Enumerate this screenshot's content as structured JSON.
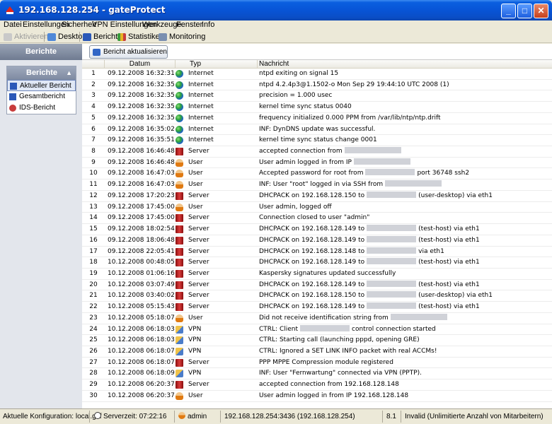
{
  "window": {
    "title": "192.168.128.254 - gateProtect",
    "controls": {
      "minimize": "_",
      "maximize": "□",
      "close": "✕"
    }
  },
  "menu": [
    "Datei",
    "Einstellungen",
    "Sicherheit",
    "VPN Einstellungen",
    "Werkzeuge",
    "Fenster",
    "Info"
  ],
  "toolbar": {
    "activate": "Aktivieren",
    "desktop": "Desktop",
    "reports": "Berichte",
    "statistics": "Statistiken",
    "monitoring": "Monitoring"
  },
  "sidebar": {
    "header": "Berichte",
    "panel_title": "Berichte",
    "items": [
      "Aktueller Bericht",
      "Gesamtbericht",
      "IDS-Bericht"
    ]
  },
  "update_button": "Bericht aktualisieren",
  "columns": {
    "num": "",
    "date": "Datum",
    "type": "Typ",
    "message": "Nachricht"
  },
  "rows": [
    {
      "n": "1",
      "date": "09.12.2008 16:32:31",
      "type": "Internet",
      "msg": "ntpd exiting on signal 15"
    },
    {
      "n": "2",
      "date": "09.12.2008 16:32:35",
      "type": "Internet",
      "msg": "ntpd 4.2.4p3@1.1502-o Mon Sep 29 19:44:10 UTC 2008 (1)"
    },
    {
      "n": "3",
      "date": "09.12.2008 16:32:35",
      "type": "Internet",
      "msg": "precision = 1.000 usec"
    },
    {
      "n": "4",
      "date": "09.12.2008 16:32:35",
      "type": "Internet",
      "msg": "kernel time sync status 0040"
    },
    {
      "n": "5",
      "date": "09.12.2008 16:32:35",
      "type": "Internet",
      "msg": "frequency initialized 0.000 PPM from /var/lib/ntp/ntp.drift"
    },
    {
      "n": "6",
      "date": "09.12.2008 16:35:02",
      "type": "Internet",
      "msg": "INF: DynDNS update was successful."
    },
    {
      "n": "7",
      "date": "09.12.2008 16:35:51",
      "type": "Internet",
      "msg": "kernel time sync status change 0001"
    },
    {
      "n": "8",
      "date": "09.12.2008 16:46:48",
      "type": "Server",
      "msg": "accepted connection from"
    },
    {
      "n": "9",
      "date": "09.12.2008 16:46:48",
      "type": "User",
      "msg": "User admin logged in from IP"
    },
    {
      "n": "10",
      "date": "09.12.2008 16:47:03",
      "type": "User",
      "msg": "Accepted password for root from",
      "msg2": "port 36748 ssh2"
    },
    {
      "n": "11",
      "date": "09.12.2008 16:47:03",
      "type": "User",
      "msg": "INF: User \"root\" logged in via SSH from"
    },
    {
      "n": "12",
      "date": "09.12.2008 17:20:23",
      "type": "Server",
      "msg": "DHCPACK on 192.168.128.150 to",
      "msg2": "(user-desktop) via eth1"
    },
    {
      "n": "13",
      "date": "09.12.2008 17:45:00",
      "type": "User",
      "msg": "User admin, logged off"
    },
    {
      "n": "14",
      "date": "09.12.2008 17:45:00",
      "type": "Server",
      "msg": "Connection closed to user \"admin\""
    },
    {
      "n": "15",
      "date": "09.12.2008 18:02:54",
      "type": "Server",
      "msg": "DHCPACK on 192.168.128.149 to",
      "msg2": "(test-host) via eth1"
    },
    {
      "n": "16",
      "date": "09.12.2008 18:06:48",
      "type": "Server",
      "msg": "DHCPACK on 192.168.128.149 to",
      "msg2": "(test-host) via eth1"
    },
    {
      "n": "17",
      "date": "09.12.2008 22:05:41",
      "type": "Server",
      "msg": "DHCPACK on 192.168.128.148 to",
      "msg2": "via eth1"
    },
    {
      "n": "18",
      "date": "10.12.2008 00:48:05",
      "type": "Server",
      "msg": "DHCPACK on 192.168.128.149 to",
      "msg2": "(test-host) via eth1"
    },
    {
      "n": "19",
      "date": "10.12.2008 01:06:16",
      "type": "Server",
      "msg": "Kaspersky signatures updated successfully"
    },
    {
      "n": "20",
      "date": "10.12.2008 03:07:49",
      "type": "Server",
      "msg": "DHCPACK on 192.168.128.149 to",
      "msg2": "(test-host) via eth1"
    },
    {
      "n": "21",
      "date": "10.12.2008 03:40:02",
      "type": "Server",
      "msg": "DHCPACK on 192.168.128.150 to",
      "msg2": "(user-desktop) via eth1"
    },
    {
      "n": "22",
      "date": "10.12.2008 05:15:43",
      "type": "Server",
      "msg": "DHCPACK on 192.168.128.149 to",
      "msg2": "(test-host) via eth1"
    },
    {
      "n": "23",
      "date": "10.12.2008 05:18:07",
      "type": "User",
      "msg": "Did not receive identification string from"
    },
    {
      "n": "24",
      "date": "10.12.2008 06:18:03",
      "type": "VPN",
      "msg": "CTRL: Client",
      "msg2": "control connection started"
    },
    {
      "n": "25",
      "date": "10.12.2008 06:18:03",
      "type": "VPN",
      "msg": "CTRL: Starting call (launching pppd, opening GRE)"
    },
    {
      "n": "26",
      "date": "10.12.2008 06:18:07",
      "type": "VPN",
      "msg": "CTRL: Ignored a SET LINK INFO packet with real ACCMs!"
    },
    {
      "n": "27",
      "date": "10.12.2008 06:18:07",
      "type": "Server",
      "msg": "PPP MPPE Compression module registered"
    },
    {
      "n": "28",
      "date": "10.12.2008 06:18:09",
      "type": "VPN",
      "msg": "INF: User \"Fernwartung\" connected via VPN (PPTP)."
    },
    {
      "n": "29",
      "date": "10.12.2008 06:20:37",
      "type": "Server",
      "msg": "accepted connection from 192.168.128.148"
    },
    {
      "n": "30",
      "date": "10.12.2008 06:20:37",
      "type": "User",
      "msg": "User admin logged in from IP 192.168.128.148"
    }
  ],
  "status": {
    "config": "Aktuelle Konfiguration: local.gcf",
    "server_time": "Serverzeit: 07:22:16",
    "user": "admin",
    "connection": "192.168.128.254:3436 (192.168.128.254)",
    "version": "8.1",
    "license": "Invalid (Unlimitierte Anzahl von Mitarbeitern)"
  },
  "colors": {
    "titlebar": "#0854d6",
    "selection": "#e0e8f6"
  }
}
